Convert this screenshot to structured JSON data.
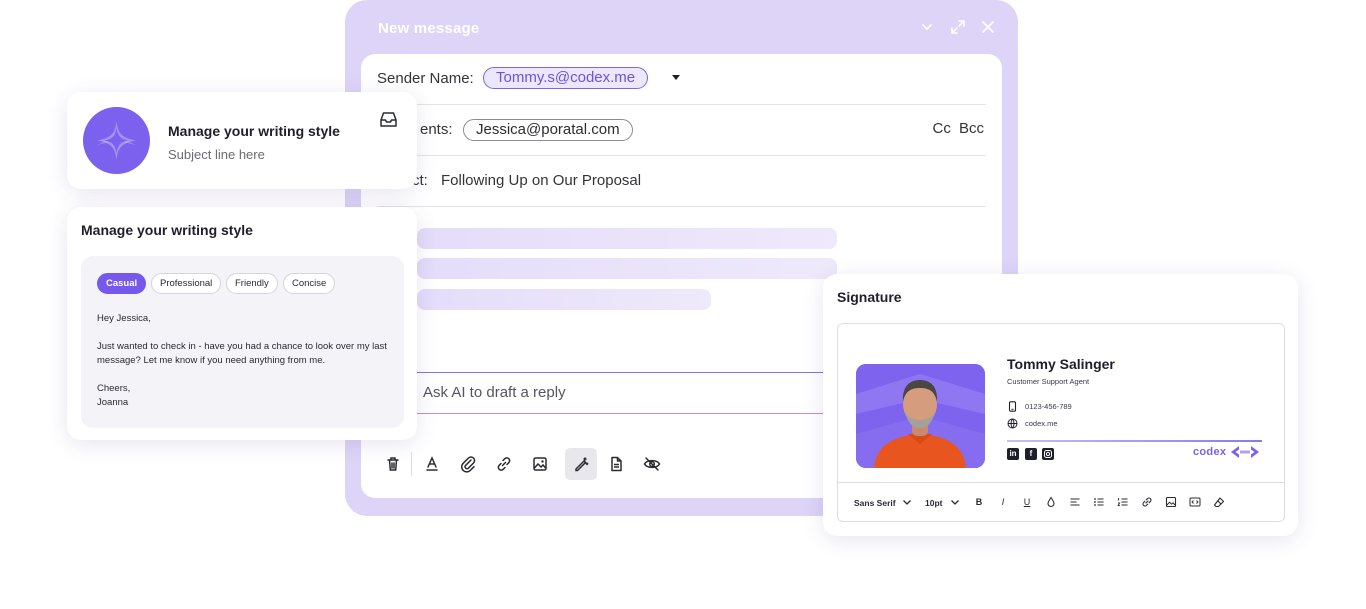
{
  "compose": {
    "title": "New message",
    "sender_label": "Sender Name:",
    "sender_value": "Tommy.s@codex.me",
    "recipients_label": "ents:",
    "recipient_value": "Jessica@poratal.com",
    "cc_bcc": "Cc  Bcc",
    "subject_label": "ct:",
    "subject_value": "Following Up on Our Proposal",
    "ask_ai_placeholder": "Ask AI to draft a reply"
  },
  "writing_card": {
    "title": "Manage your writing style",
    "subtitle": "Subject line here"
  },
  "style_panel": {
    "title": "Manage your writing style",
    "tones": [
      "Casual",
      "Professional",
      "Friendly",
      "Concise"
    ],
    "active_tone": "Casual",
    "greeting": "Hey Jessica,",
    "body": "Just wanted to check in - have you had a chance to look over my last message? Let me know if you need anything from me.",
    "closing": "Cheers,",
    "name": "Joanna"
  },
  "signature": {
    "title": "Signature",
    "name": "Tommy Salinger",
    "role": "Customer Support Agent",
    "phone": "0123-456-789",
    "website": "codex.me",
    "brand": "codex",
    "font": "Sans Serif",
    "size": "10pt",
    "bold": "B",
    "italic": "I",
    "underline": "U"
  },
  "colors": {
    "accent": "#7659ec",
    "compose_bg": "#ddd4f7"
  }
}
